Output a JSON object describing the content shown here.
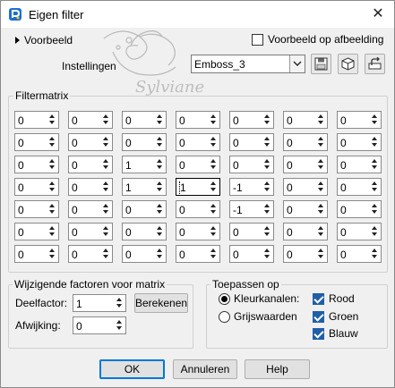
{
  "window": {
    "title": "Eigen filter",
    "close_glyph": "✕"
  },
  "top": {
    "preview_label": "Voorbeeld",
    "preview_on_image_label": "Voorbeeld op afbeelding",
    "preview_on_image_checked": false,
    "settings_label": "Instellingen",
    "settings_value": "Emboss_3"
  },
  "matrix": {
    "title": "Filtermatrix",
    "rows": [
      [
        "0",
        "0",
        "0",
        "0",
        "0",
        "0",
        "0"
      ],
      [
        "0",
        "0",
        "0",
        "0",
        "0",
        "0",
        "0"
      ],
      [
        "0",
        "0",
        "1",
        "0",
        "0",
        "0",
        "0"
      ],
      [
        "0",
        "0",
        "1",
        "1",
        "-1",
        "0",
        "0"
      ],
      [
        "0",
        "0",
        "0",
        "0",
        "-1",
        "0",
        "0"
      ],
      [
        "0",
        "0",
        "0",
        "0",
        "0",
        "0",
        "0"
      ],
      [
        "0",
        "0",
        "0",
        "0",
        "0",
        "0",
        "0"
      ]
    ]
  },
  "factors": {
    "title": "Wijzigende factoren voor matrix",
    "divisor_label": "Deelfactor:",
    "divisor_value": "1",
    "calc_label": "Berekenen",
    "bias_label": "Afwijking:",
    "bias_value": "0"
  },
  "apply": {
    "title": "Toepassen op",
    "color_channels_label": "Kleurkanalen:",
    "grayscale_label": "Grijswaarden",
    "mode_selected": "color",
    "red_label": "Rood",
    "green_label": "Groen",
    "blue_label": "Blauw",
    "red_checked": true,
    "green_checked": true,
    "blue_checked": true
  },
  "buttons": {
    "ok": "OK",
    "cancel": "Annuleren",
    "help": "Help"
  },
  "colors": {
    "accent": "#0078d4",
    "check_fill": "#1f5fa8",
    "title_icon": "#1c6fd1"
  }
}
